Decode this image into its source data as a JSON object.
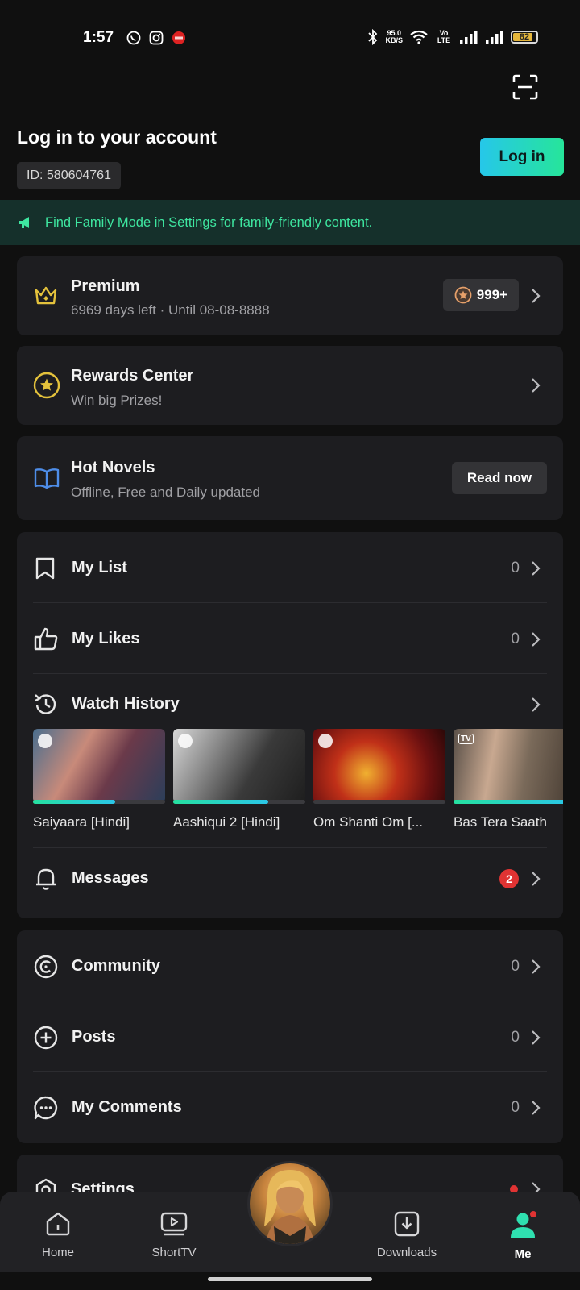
{
  "status_bar": {
    "time": "1:57",
    "net_speed_value": "95.0",
    "net_speed_unit": "KB/S",
    "volte": "Vo LTE",
    "battery": "82"
  },
  "header": {
    "title": "Log in to your account",
    "user_id": "ID: 580604761",
    "login_label": "Log in"
  },
  "notice": {
    "text": "Find Family Mode in Settings for family-friendly content."
  },
  "premium": {
    "title": "Premium",
    "subtitle": "6969 days left · Until 08-08-8888",
    "coins": "999+"
  },
  "rewards": {
    "title": "Rewards Center",
    "subtitle": "Win big Prizes!"
  },
  "novels": {
    "title": "Hot Novels",
    "subtitle": "Offline, Free and Daily updated",
    "button": "Read now"
  },
  "lists": {
    "my_list": {
      "label": "My List",
      "count": "0"
    },
    "my_likes": {
      "label": "My Likes",
      "count": "0"
    },
    "watch_history": {
      "label": "Watch History"
    },
    "history_items": [
      {
        "title": "Saiyaara [Hindi]",
        "progress": 0.62,
        "kind": "play"
      },
      {
        "title": "Aashiqui 2 [Hindi]",
        "progress": 0.72,
        "kind": "play"
      },
      {
        "title": "Om Shanti Om [...",
        "progress": 0.0,
        "kind": "play"
      },
      {
        "title": "Bas Tera Saath",
        "progress": 0.9,
        "kind": "tv"
      }
    ],
    "messages": {
      "label": "Messages",
      "badge": "2"
    }
  },
  "community": {
    "community": {
      "label": "Community",
      "count": "0"
    },
    "posts": {
      "label": "Posts",
      "count": "0"
    },
    "comments": {
      "label": "My Comments",
      "count": "0"
    }
  },
  "settings": {
    "label": "Settings"
  },
  "bottom_nav": {
    "home": "Home",
    "shorttv": "ShortTV",
    "downloads": "Downloads",
    "me": "Me"
  },
  "colors": {
    "accent_green": "#3ee6a0",
    "accent_cyan": "#26c7e9",
    "badge_red": "#e03333",
    "premium_gold": "#e4c23c"
  }
}
